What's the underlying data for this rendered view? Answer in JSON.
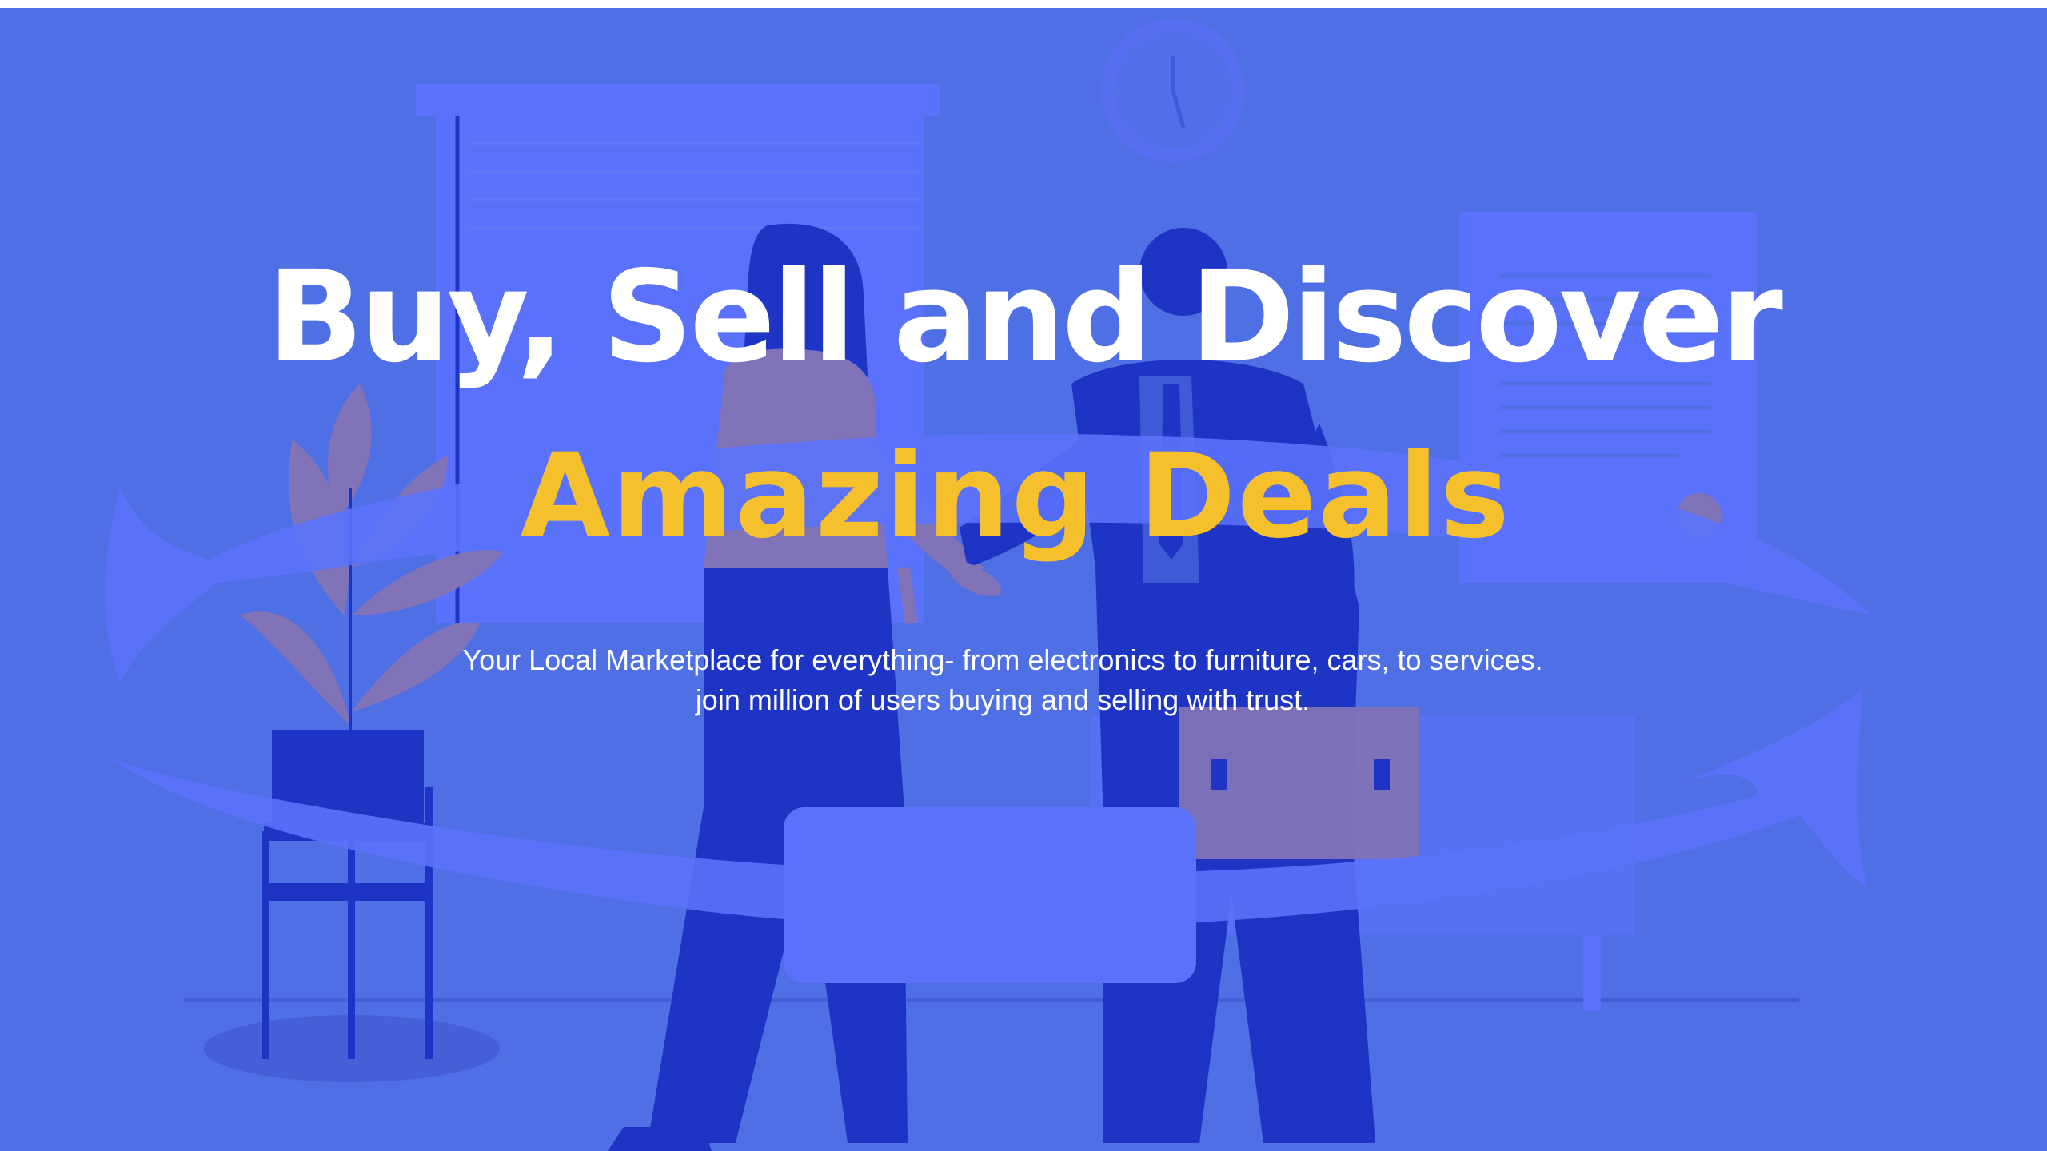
{
  "hero": {
    "headline_main": "Buy, Sell and Discover",
    "headline_accent": "Amazing Deals",
    "subtitle_line_1": "Your Local Marketplace for everything- from electronics to furniture, cars, to services.",
    "subtitle_line_2": "join million of users buying and selling with trust."
  },
  "colors": {
    "background": "#4f6fe4",
    "headline_main": "#ffffff",
    "headline_accent": "#f6c02c",
    "subtitle": "#ffffff",
    "illustration_dark_blue": "#1e34c4",
    "illustration_light_blue": "#5a72fb",
    "illustration_tan": "#8173b7",
    "button_fill": "#5a72fb"
  },
  "icons": {
    "illustration": "handshake-scene"
  }
}
